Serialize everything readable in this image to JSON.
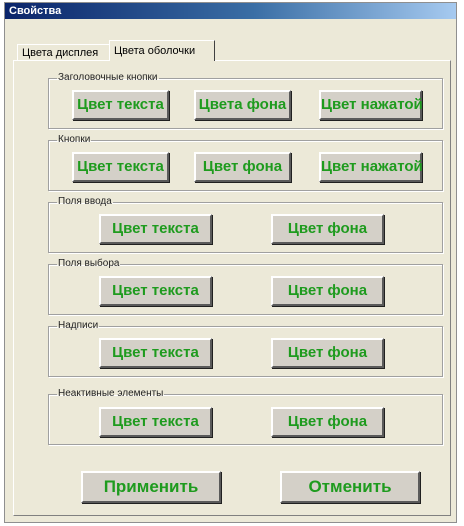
{
  "window": {
    "title": "Свойства"
  },
  "tabs": [
    {
      "label": "Цвета дисплея",
      "active": false
    },
    {
      "label": "Цвета оболочки",
      "active": true
    }
  ],
  "groups": [
    {
      "title": "Заголовочные кнопки",
      "buttons": [
        "Цвет текста",
        "Цвета фона",
        "Цвет нажатой"
      ]
    },
    {
      "title": "Кнопки",
      "buttons": [
        "Цвет текста",
        "Цвет фона",
        "Цвет нажатой"
      ]
    },
    {
      "title": "Поля ввода",
      "buttons": [
        "Цвет текста",
        "Цвет фона"
      ]
    },
    {
      "title": "Поля выбора",
      "buttons": [
        "Цвет текста",
        "Цвет фона"
      ]
    },
    {
      "title": "Надписи",
      "buttons": [
        "Цвет текста",
        "Цвет фона"
      ]
    },
    {
      "title": "Неактивные элементы",
      "buttons": [
        "Цвет текста",
        "Цвет фона"
      ]
    }
  ],
  "actions": {
    "apply_label": "Применить",
    "cancel_label": "Отменить"
  },
  "colors": {
    "button_text": "#1e9b1e",
    "window_background": "#ece9d8",
    "title_bar": "#0a246a"
  }
}
